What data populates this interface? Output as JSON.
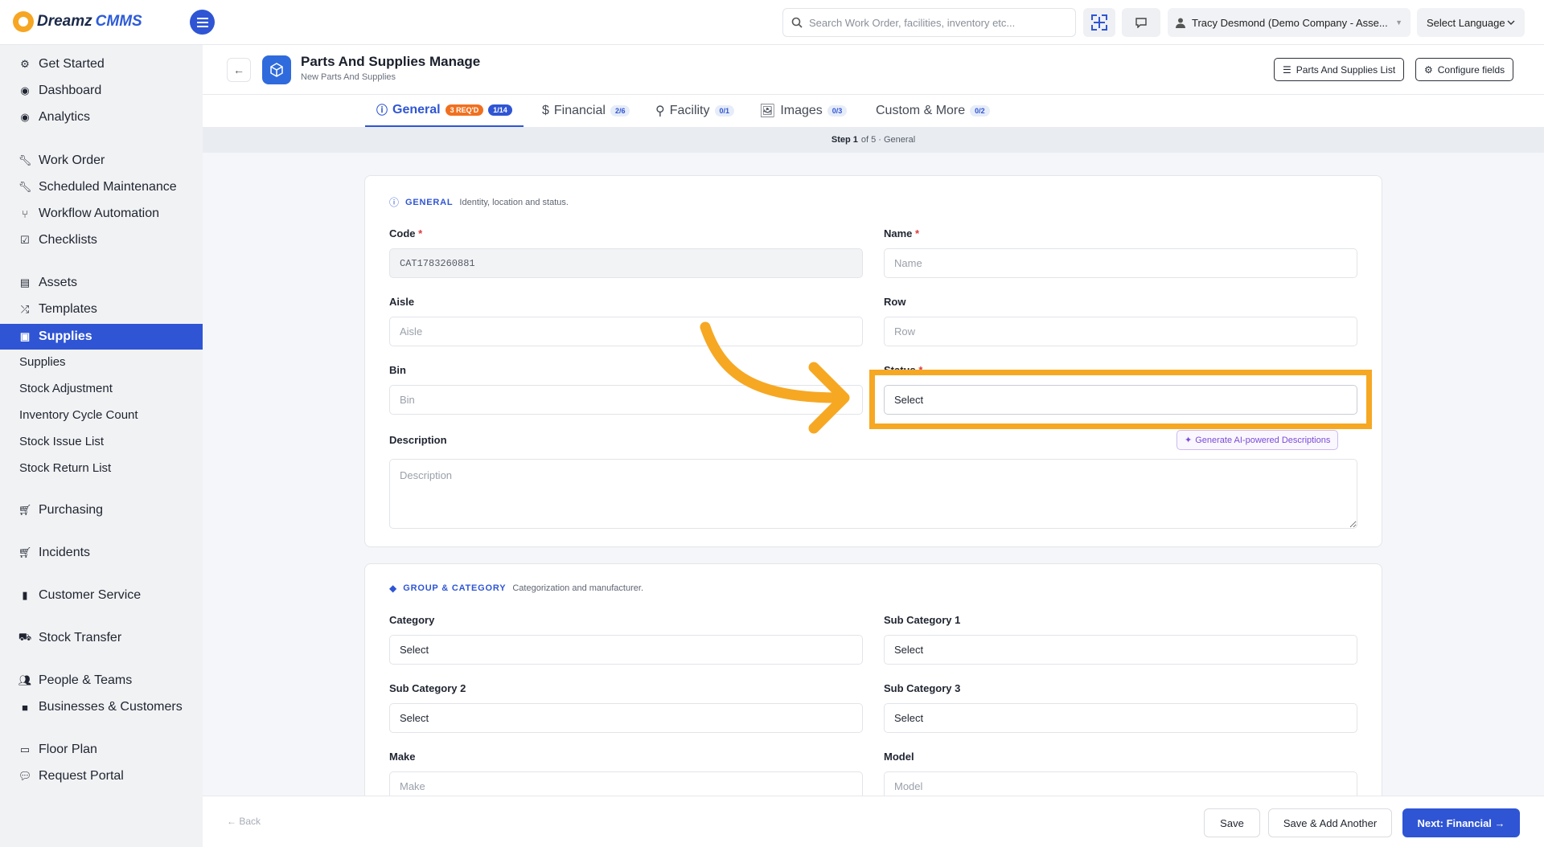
{
  "app": {
    "logo_part1": "Dreamz",
    "logo_part2": "CMMS"
  },
  "topbar": {
    "search_placeholder": "Search Work Order, facilities, inventory etc...",
    "user": "Tracy Desmond (Demo Company - Asse...",
    "language": "Select Language"
  },
  "sidebar": {
    "items": [
      {
        "label": "Get Started",
        "icon": "gears-icon"
      },
      {
        "label": "Dashboard",
        "icon": "gauge-icon"
      },
      {
        "label": "Analytics",
        "icon": "gauge-icon"
      },
      {
        "label": "Work Order",
        "icon": "wrench-icon"
      },
      {
        "label": "Scheduled Maintenance",
        "icon": "wrench-icon"
      },
      {
        "label": "Workflow Automation",
        "icon": "branch-icon"
      },
      {
        "label": "Checklists",
        "icon": "checkbox-icon"
      },
      {
        "label": "Assets",
        "icon": "archive-icon"
      },
      {
        "label": "Templates",
        "icon": "shuffle-icon"
      },
      {
        "label": "Supplies",
        "icon": "box-icon"
      },
      {
        "label": "Supplies",
        "icon": ""
      },
      {
        "label": "Stock Adjustment",
        "icon": ""
      },
      {
        "label": "Inventory Cycle Count",
        "icon": ""
      },
      {
        "label": "Stock Issue List",
        "icon": ""
      },
      {
        "label": "Stock Return List",
        "icon": ""
      },
      {
        "label": "Purchasing",
        "icon": "cart-icon"
      },
      {
        "label": "Incidents",
        "icon": "cart-icon"
      },
      {
        "label": "Customer Service",
        "icon": "file-icon"
      },
      {
        "label": "Stock Transfer",
        "icon": "truck-icon"
      },
      {
        "label": "People & Teams",
        "icon": "users-icon"
      },
      {
        "label": "Businesses & Customers",
        "icon": "briefcase-icon"
      },
      {
        "label": "Floor Plan",
        "icon": "map-icon"
      },
      {
        "label": "Request Portal",
        "icon": "chat-icon"
      }
    ]
  },
  "page": {
    "title": "Parts And Supplies Manage",
    "subtitle": "New Parts And Supplies",
    "list_button": "Parts And Supplies List",
    "configure_button": "Configure fields"
  },
  "tabs": [
    {
      "label": "General",
      "badge_req": "3 REQ'D",
      "count": "1/14"
    },
    {
      "label": "Financial",
      "count": "2/6"
    },
    {
      "label": "Facility",
      "count": "0/1"
    },
    {
      "label": "Images",
      "count": "0/3"
    },
    {
      "label": "Custom & More",
      "count": "0/2"
    }
  ],
  "stepbar": {
    "step": "Step 1",
    "of": "of 5 · General"
  },
  "general": {
    "title": "GENERAL",
    "desc": "Identity, location and status.",
    "code_label": "Code",
    "code_value": "CAT1783260881",
    "name_label": "Name",
    "name_placeholder": "Name",
    "aisle_label": "Aisle",
    "aisle_placeholder": "Aisle",
    "row_label": "Row",
    "row_placeholder": "Row",
    "bin_label": "Bin",
    "bin_placeholder": "Bin",
    "status_label": "Status",
    "status_value": "Select",
    "description_label": "Description",
    "description_placeholder": "Description",
    "ai_button": "Generate AI-powered Descriptions"
  },
  "group": {
    "title": "GROUP & CATEGORY",
    "desc": "Categorization and manufacturer.",
    "category_label": "Category",
    "category_value": "Select",
    "subcat1_label": "Sub Category 1",
    "subcat1_value": "Select",
    "subcat2_label": "Sub Category 2",
    "subcat2_value": "Select",
    "subcat3_label": "Sub Category 3",
    "subcat3_value": "Select",
    "make_label": "Make",
    "make_placeholder": "Make",
    "model_label": "Model",
    "model_placeholder": "Model"
  },
  "footer": {
    "back": "← Back",
    "save": "Save",
    "save_add": "Save & Add Another",
    "next": "Next: Financial →"
  },
  "colors": {
    "primary": "#2f55d4",
    "highlight": "#f6a823",
    "required": "#e03b3b",
    "req_badge": "#f0701f"
  }
}
